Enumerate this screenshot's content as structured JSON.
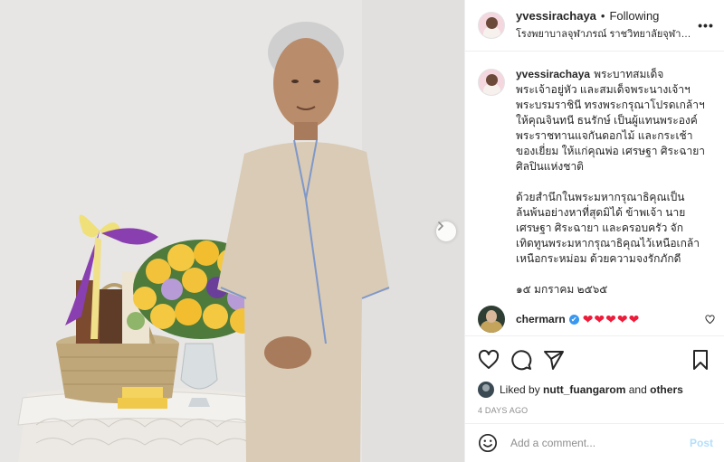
{
  "post": {
    "username": "yvessirachaya",
    "follow_status": "Following",
    "location": "โรงพยาบาลจุฬาภรณ์ ราชวิทยาลัยจุฬาภรณ์",
    "caption_username": "yvessirachaya",
    "caption_p1": "พระบาทสมเด็จพระเจ้าอยู่หัว และสมเด็จพระนางเจ้าฯพระบรมราชินี ทรงพระกรุณาโปรดเกล้าฯ ให้คุณจินทนี ธนรักษ์ เป็นผู้แทนพระองค์ พระราชทานแจกันดอกไม้ และกระเช้าของเยี่ยม ให้แก่คุณพ่อ เศรษฐา ศิระฉายา ศิลปินแห่งชาติ",
    "caption_p2": "ด้วยสำนึกในพระมหากรุณาธิคุณเป็นล้นพ้นอย่างหาที่สุดมิได้ ข้าพเจ้า นายเศรษฐา ศิระฉายา และครอบครัว จักเทิดทูนพระมหากรุณาธิคุณไว้เหนือเกล้าเหนือกระหม่อม ด้วยความจงรักภักดี",
    "caption_p3": "๑๕ มกราคม ๒๕๖๕",
    "time_ago": "4d",
    "comment": {
      "username": "chermarn",
      "verified_mark": "✔",
      "text": "❤❤❤❤❤"
    },
    "liked_by_prefix": "Liked by",
    "liked_by_user": "nutt_fuangarom",
    "liked_by_and": "and",
    "liked_by_others": "others",
    "date": "4 DAYS AGO",
    "add_comment_placeholder": "Add a comment...",
    "post_button": "Post"
  },
  "icons": {
    "more": "more-options-icon",
    "heart": "heart-icon",
    "comment": "comment-icon",
    "share": "share-icon",
    "save": "bookmark-icon",
    "emoji": "emoji-icon",
    "next": "chevron-right-icon"
  },
  "colors": {
    "accent_blue": "#3897f0",
    "heart_red": "#ed1c3a",
    "post_button_disabled": "#b2dffc",
    "muted_text": "#8e8e8e"
  }
}
